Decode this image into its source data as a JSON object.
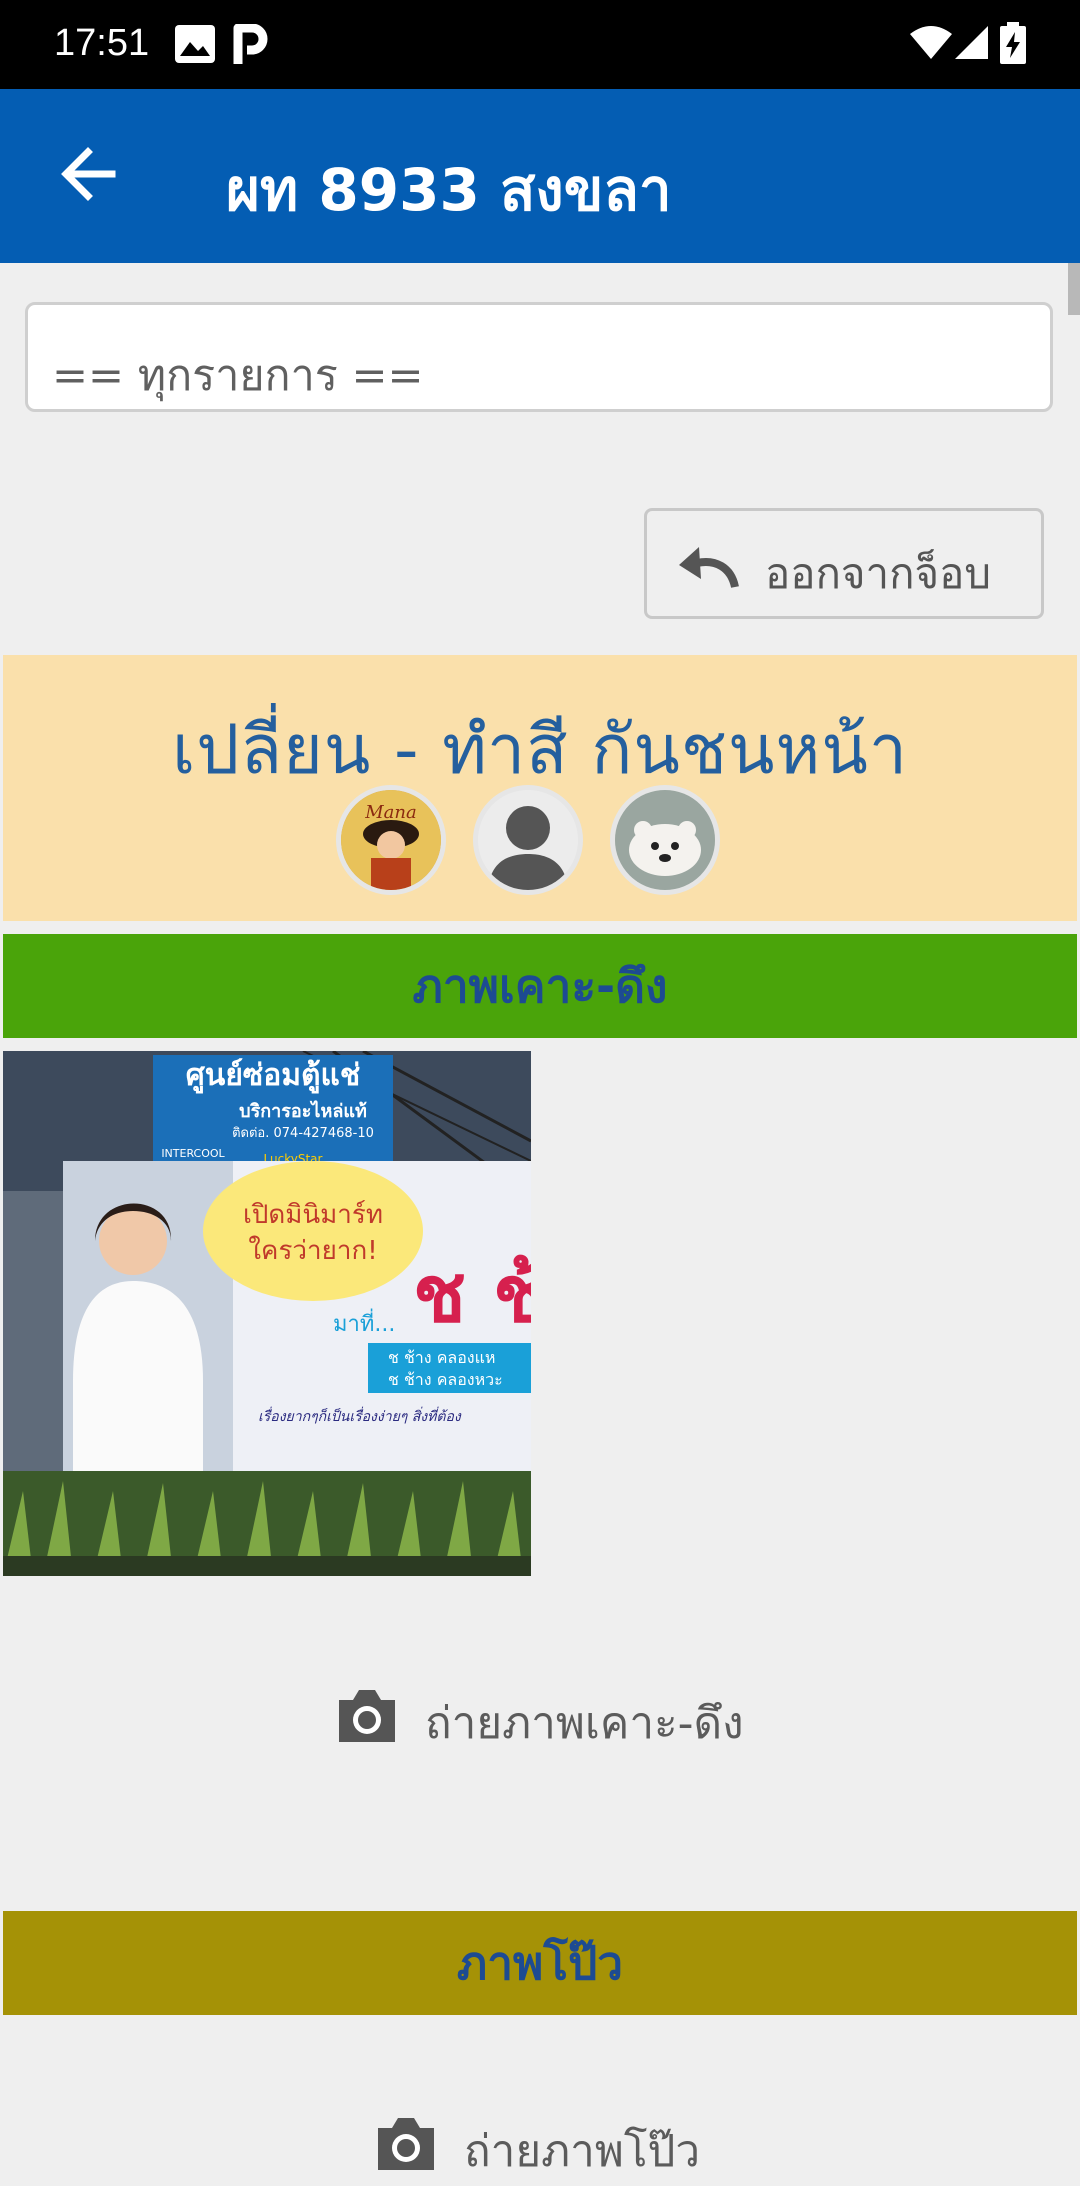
{
  "status_bar": {
    "time": "17:51",
    "icons": [
      "image-icon",
      "parking-icon",
      "wifi-icon",
      "signal-icon",
      "battery-charging-icon"
    ]
  },
  "app_bar": {
    "title": "ผท 8933 สงขลา",
    "back_icon": "arrow-left-icon",
    "color": "#045db3"
  },
  "filter": {
    "selected": "== ทุกรายการ =="
  },
  "exit_button": {
    "label": "ออกจากจ็อบ",
    "icon": "undo-icon"
  },
  "job": {
    "title": "เปลี่ยน - ทำสี กันชนหน้า",
    "background": "#fae0ab",
    "avatars": [
      "avatar-cartoon",
      "avatar-default-person",
      "avatar-polar-bear"
    ]
  },
  "sections": [
    {
      "header": "ภาพเคาะ-ดึง",
      "color": "#4aa40a",
      "camera_label": "ถ่ายภาพเคาะ-ดึง",
      "photo": {
        "sign_top": "ศูนย์ซ่อมตู้แช่",
        "sign_service": "บริการอะไหล่แท้",
        "sign_phone": "ติดต่อ. 074-427468-10",
        "brand_1": "INTERCOOL",
        "brand_2": "LuckyStar",
        "bubble_1": "เปิดมินิมาร์ท",
        "bubble_2": "ใครว่ายาก!",
        "big_text": "ช ช้",
        "mathi": "มาที่...",
        "line_1": "ช ช้าง คลองแห",
        "line_2": "ช ช้าง คลองหวะ",
        "slogan": "เรื่องยากๆก็เป็นเรื่องง่ายๆ สิ่งที่ต้อง"
      }
    },
    {
      "header": "ภาพโป๊ว",
      "color": "#a59206",
      "camera_label": "ถ่ายภาพโป๊ว"
    }
  ]
}
